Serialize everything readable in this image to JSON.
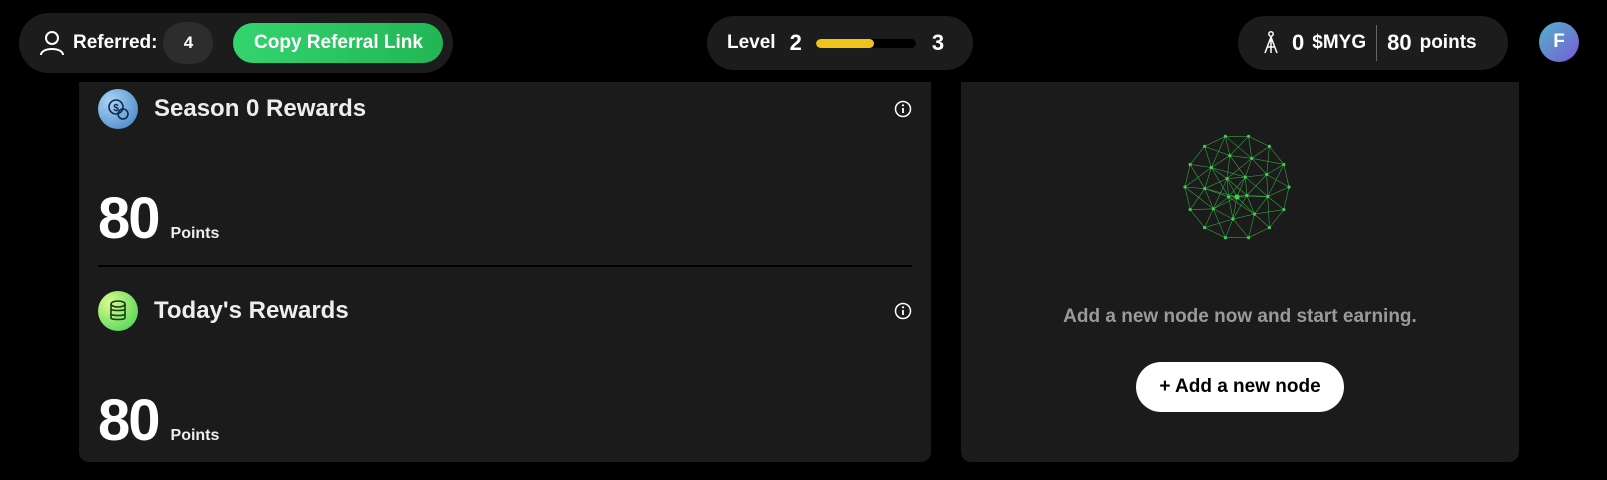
{
  "referral": {
    "label": "Referred:",
    "count": "4",
    "copy_label": "Copy Referral Link"
  },
  "level": {
    "label": "Level",
    "current": "2",
    "next": "3",
    "progress_fraction": 0.58,
    "bar_color": "#f1c21b"
  },
  "balance": {
    "token_amount": "0",
    "token_unit": "$MYG",
    "points_amount": "80",
    "points_unit": "points"
  },
  "avatar": {
    "initial": "F"
  },
  "rewards": {
    "season": {
      "title": "Season 0 Rewards",
      "value": "80",
      "unit": "Points",
      "icon": "coin-bag-icon"
    },
    "today": {
      "title": "Today's Rewards",
      "value": "80",
      "unit": "Points",
      "icon": "coin-stack-icon"
    }
  },
  "node": {
    "message": "Add a new node now and start earning.",
    "button_label": "+ Add a new node",
    "graphic": "network-globe-icon",
    "accent_color": "#3ecf4f"
  },
  "colors": {
    "copy_button": "#2ecc66",
    "card_bg": "#1b1b1b",
    "pill_bg": "#1c1c1c"
  }
}
